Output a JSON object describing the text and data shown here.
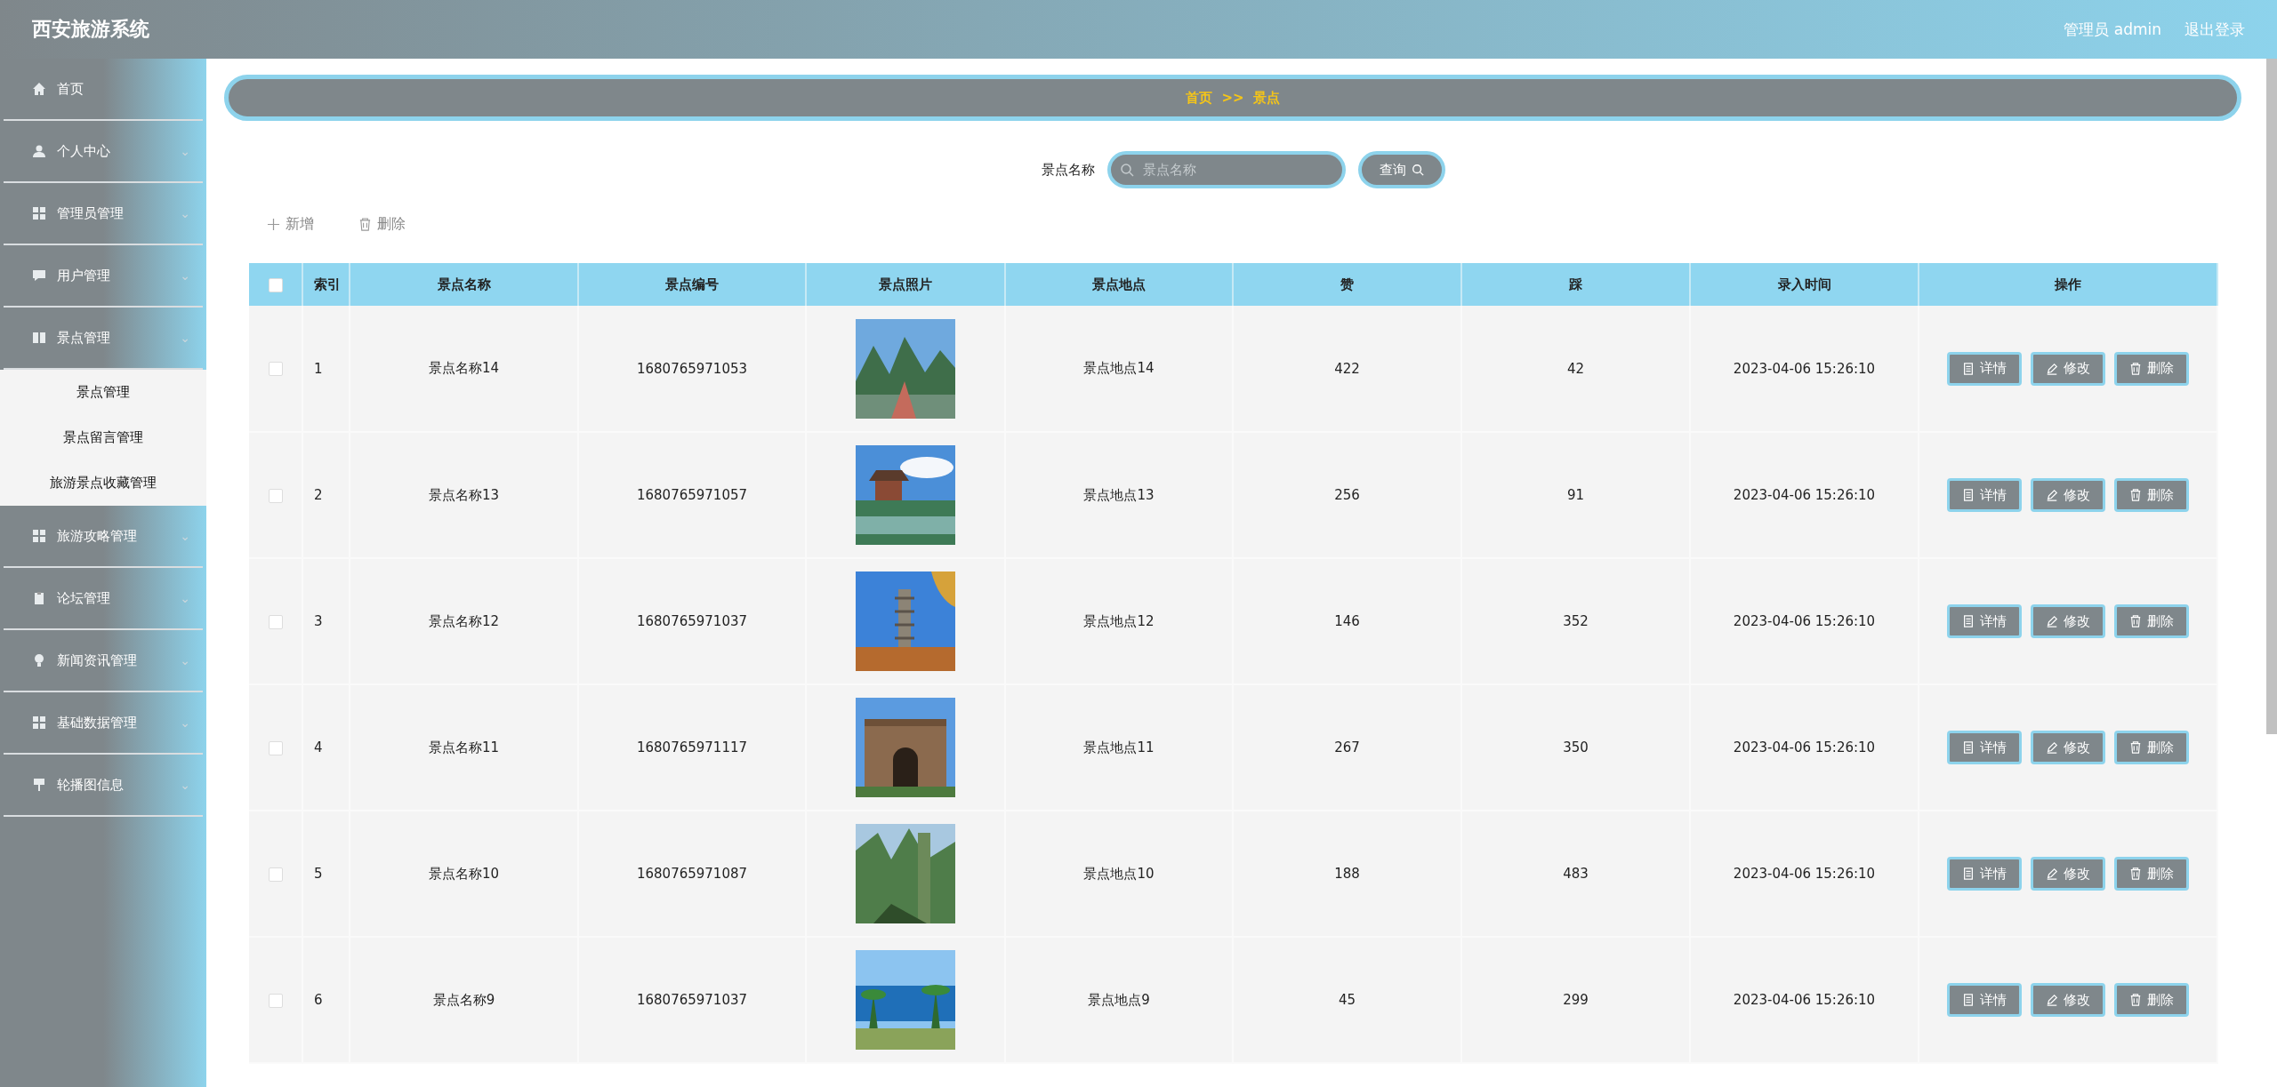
{
  "header": {
    "title": "西安旅游系统",
    "user": "管理员 admin",
    "logout": "退出登录"
  },
  "sidebar": {
    "items": [
      {
        "label": "首页"
      },
      {
        "label": "个人中心",
        "chevron": "⌄"
      },
      {
        "label": "管理员管理",
        "chevron": "⌄"
      },
      {
        "label": "用户管理",
        "chevron": "⌄"
      },
      {
        "label": "景点管理",
        "expanded": true,
        "chevron": "⌄",
        "children": [
          {
            "label": "景点管理"
          },
          {
            "label": "景点留言管理"
          },
          {
            "label": "旅游景点收藏管理"
          }
        ]
      },
      {
        "label": "旅游攻略管理",
        "chevron": "⌄"
      },
      {
        "label": "论坛管理",
        "chevron": "⌄"
      },
      {
        "label": "新闻资讯管理",
        "chevron": "⌄"
      },
      {
        "label": "基础数据管理",
        "chevron": "⌄"
      },
      {
        "label": "轮播图信息",
        "chevron": "⌄"
      }
    ]
  },
  "breadcrumb": [
    "首页",
    ">>",
    "景点"
  ],
  "search": {
    "label": "景点名称",
    "placeholder": "景点名称",
    "button": "查询"
  },
  "actions": [
    "新增",
    "删除"
  ],
  "table": {
    "header_checkbox": {
      "checked": false
    },
    "columns": [
      "索引",
      "景点名称",
      "景点编号",
      "景点照片",
      "景点地点",
      "赞",
      "踩",
      "录入时间",
      "操作"
    ],
    "rows": [
      {
        "checked": false,
        "cells": [
          "1",
          "景点名称14",
          "1680765971053",
          "",
          "景点地点14",
          "422",
          "42",
          "2023-04-06 15:26:10"
        ],
        "buttons": [
          "详情",
          "修改",
          "删除"
        ]
      },
      {
        "checked": false,
        "cells": [
          "2",
          "景点名称13",
          "1680765971057",
          "",
          "景点地点13",
          "256",
          "91",
          "2023-04-06 15:26:10"
        ],
        "buttons": [
          "详情",
          "修改",
          "删除"
        ]
      },
      {
        "checked": false,
        "cells": [
          "3",
          "景点名称12",
          "1680765971037",
          "",
          "景点地点12",
          "146",
          "352",
          "2023-04-06 15:26:10"
        ],
        "buttons": [
          "详情",
          "修改",
          "删除"
        ]
      },
      {
        "checked": false,
        "cells": [
          "4",
          "景点名称11",
          "1680765971117",
          "",
          "景点地点11",
          "267",
          "350",
          "2023-04-06 15:26:10"
        ],
        "buttons": [
          "详情",
          "修改",
          "删除"
        ]
      },
      {
        "checked": false,
        "cells": [
          "5",
          "景点名称10",
          "1680765971087",
          "",
          "景点地点10",
          "188",
          "483",
          "2023-04-06 15:26:10"
        ],
        "buttons": [
          "详情",
          "修改",
          "删除"
        ]
      },
      {
        "checked": false,
        "cells": [
          "6",
          "景点名称9",
          "1680765971037",
          "",
          "景点地点9",
          "45",
          "299",
          "2023-04-06 15:26:10"
        ],
        "buttons": [
          "详情",
          "修改",
          "删除"
        ]
      }
    ]
  }
}
